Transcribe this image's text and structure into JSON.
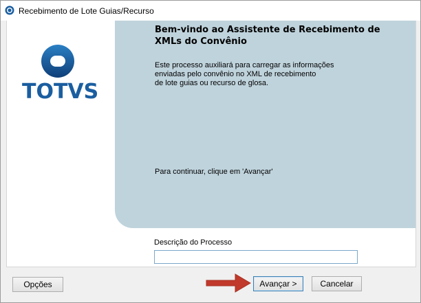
{
  "window": {
    "title": "Recebimento de Lote Guias/Recurso"
  },
  "logo": {
    "text": "TOTVS",
    "color": "#1a5ea0"
  },
  "welcome": {
    "title": "Bem-vindo ao Assistente de Recebimento de XMLs do Convênio",
    "description": "Este processo auxiliará para carregar as informações\nenviadas pelo convênio no XML de recebimento\nde lote guias ou recurso de glosa.",
    "continue_hint": "Para continuar, clique em 'Avançar'",
    "panel_color": "#bfd3dc"
  },
  "form": {
    "description_label": "Descrição do Processo",
    "description_value": ""
  },
  "footer": {
    "options_label": "Opções",
    "next_label": "Avançar >",
    "cancel_label": "Cancelar",
    "arrow_color": "#c0392b",
    "arrow_icon": "red-arrow-right-icon"
  }
}
